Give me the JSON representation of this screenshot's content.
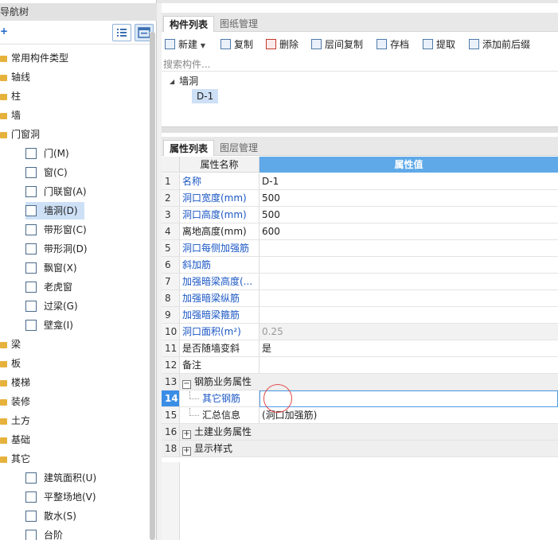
{
  "nav": {
    "title": "导航树",
    "add_glyph": "+",
    "items": {
      "common": "常用构件类型",
      "axis": "轴线",
      "column": "柱",
      "wall": "墙",
      "door_window": "门窗洞",
      "door": "门(M)",
      "window": "窗(C)",
      "door_window_combo": "门联窗(A)",
      "wall_hole": "墙洞(D)",
      "strip_window": "带形窗(C)",
      "strip_hole": "带形洞(D)",
      "bay_window": "飘窗(X)",
      "dormer": "老虎窗",
      "lintel": "过梁(G)",
      "niche": "壁龛(I)",
      "beam": "梁",
      "slab": "板",
      "stairs": "楼梯",
      "decoration": "装修",
      "earthwork": "土方",
      "foundation": "基础",
      "other": "其它",
      "building_area": "建筑面积(U)",
      "site_leveling": "平整场地(V)",
      "apron": "散水(S)",
      "steps": "台阶"
    }
  },
  "component_panel": {
    "tabs": [
      "构件列表",
      "图纸管理"
    ],
    "toolbar": {
      "new": "新建",
      "copy": "复制",
      "delete": "删除",
      "floor_copy": "层间复制",
      "archive": "存档",
      "extract": "提取",
      "add_prefix_suffix": "添加前后缀"
    },
    "search_placeholder": "搜索构件...",
    "tree": {
      "group": "墙洞",
      "item": "D-1"
    }
  },
  "property_panel": {
    "tabs": [
      "属性列表",
      "图层管理"
    ],
    "header": {
      "name": "属性名称",
      "value": "属性值"
    },
    "rows": [
      {
        "num": "1",
        "name": "名称",
        "value": "D-1"
      },
      {
        "num": "2",
        "name": "洞口宽度(mm)",
        "value": "500"
      },
      {
        "num": "3",
        "name": "洞口高度(mm)",
        "value": "500"
      },
      {
        "num": "4",
        "name": "离地高度(mm)",
        "value": "600"
      },
      {
        "num": "5",
        "name": "洞口每侧加强筋",
        "value": ""
      },
      {
        "num": "6",
        "name": "斜加筋",
        "value": ""
      },
      {
        "num": "7",
        "name": "加强暗梁高度(...",
        "value": ""
      },
      {
        "num": "8",
        "name": "加强暗梁纵筋",
        "value": ""
      },
      {
        "num": "9",
        "name": "加强暗梁箍筋",
        "value": ""
      },
      {
        "num": "10",
        "name": "洞口面积(m²)",
        "value": "0.25"
      },
      {
        "num": "11",
        "name": "是否随墙变斜",
        "value": "是"
      },
      {
        "num": "12",
        "name": "备注",
        "value": ""
      },
      {
        "num": "13",
        "name": "钢筋业务属性",
        "value": ""
      },
      {
        "num": "14",
        "name": "其它钢筋",
        "value": ""
      },
      {
        "num": "15",
        "name": "汇总信息",
        "value": "(洞口加强筋)"
      },
      {
        "num": "16",
        "name": "土建业务属性",
        "value": ""
      },
      {
        "num": "18",
        "name": "显示样式",
        "value": ""
      }
    ],
    "expander_minus": "−",
    "expander_plus": "+"
  },
  "colors": {
    "accent": "#5fa9e8",
    "selection": "#cde0f6",
    "link_blue": "#1a56c4",
    "current_row": "#3a8ee6"
  }
}
